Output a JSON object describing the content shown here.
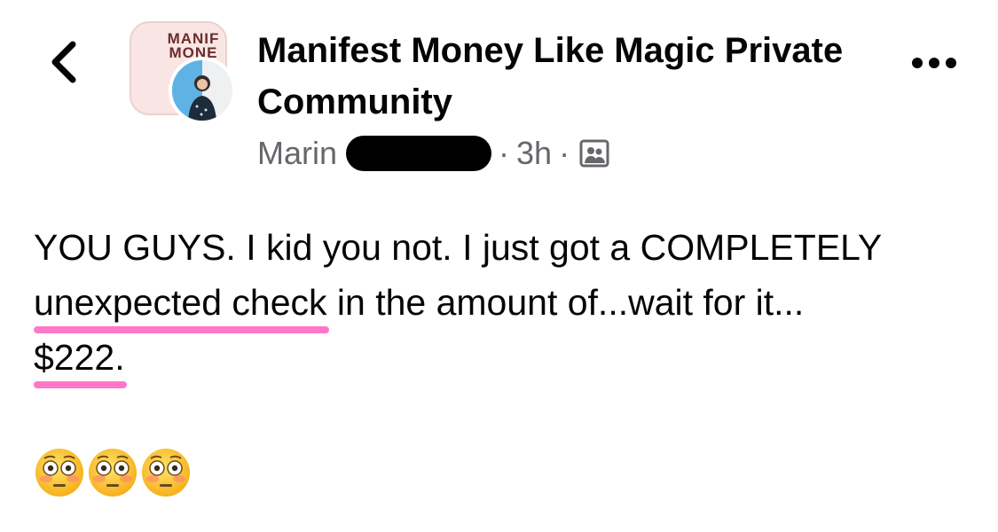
{
  "header": {
    "group_name": "Manifest Money Like Magic Private Community",
    "group_logo_text_line1": "MANIF",
    "group_logo_text_line2": "MONE",
    "author": "Marin",
    "time": "3h",
    "separator": "·",
    "icons": {
      "back": "chevron-left-icon",
      "more": "more-options-icon",
      "audience": "group-audience-icon"
    }
  },
  "post": {
    "line1": "YOU GUYS. I kid you not. I just got a COMPLETELY",
    "highlight1": "unexpected check",
    "line2_rest": " in the amount of...wait for it...",
    "highlight2": "$222.",
    "emoji_name": "flushed-face-icon",
    "emoji_count": 3
  },
  "colors": {
    "highlight": "#ff78c8",
    "meta_text": "#65676b",
    "text": "#050505"
  }
}
